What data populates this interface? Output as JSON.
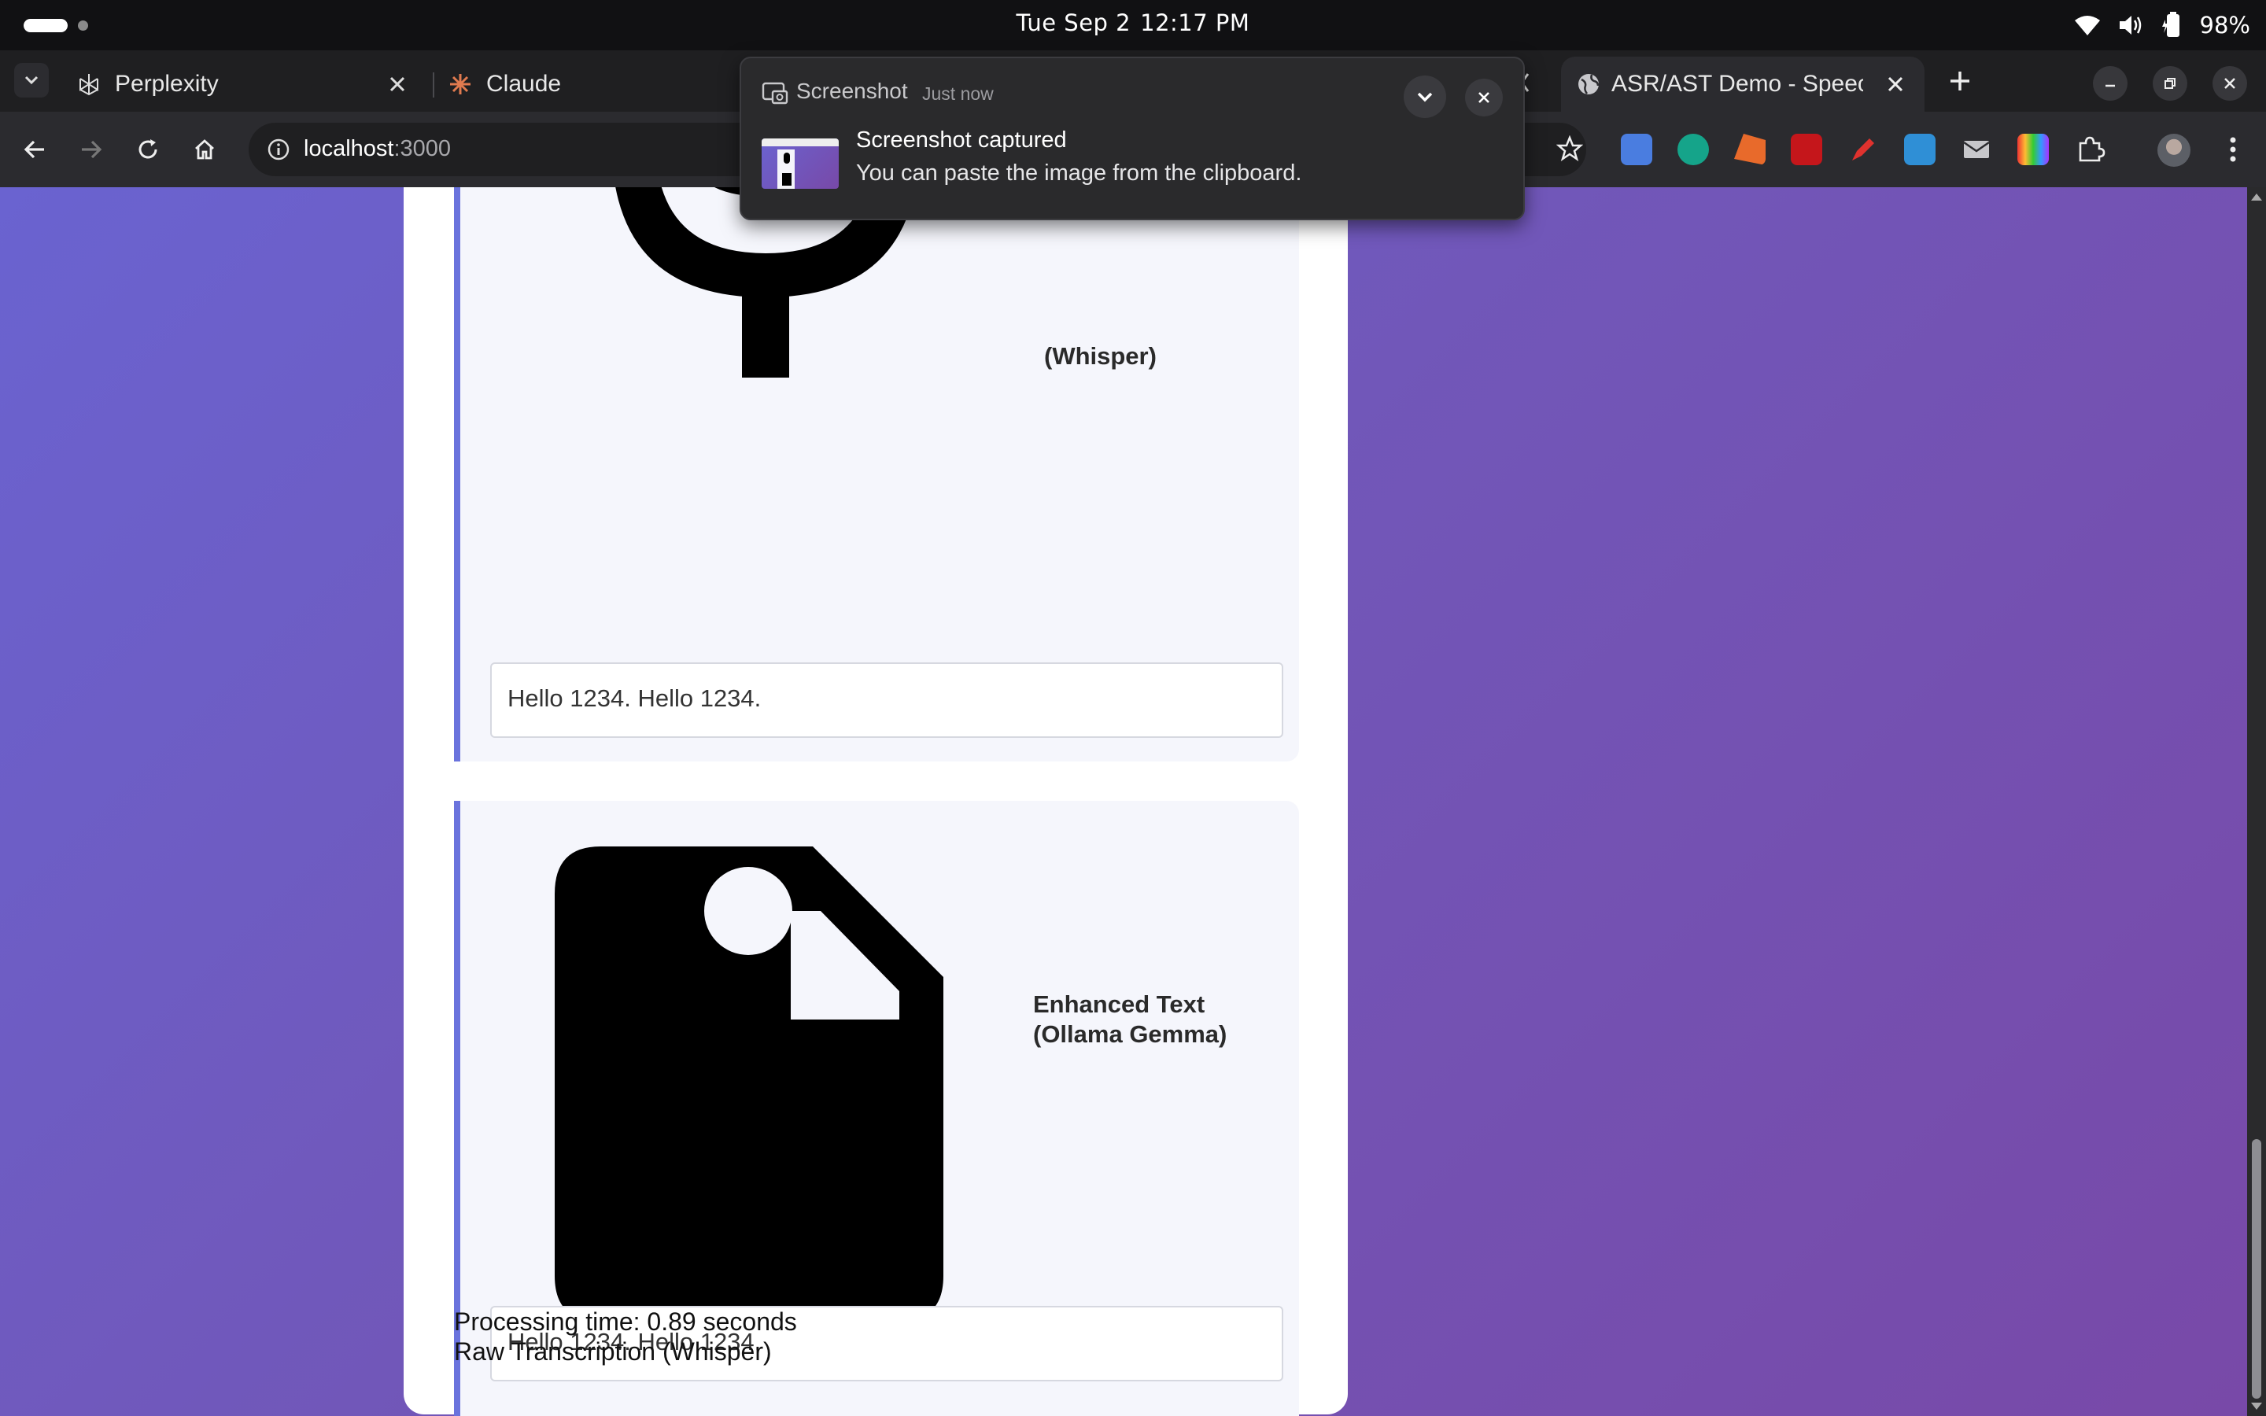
{
  "os": {
    "date": "Tue Sep 2",
    "time": "12:17 PM",
    "battery": "98%",
    "icons": [
      "activities-pill-icon",
      "workspace-dot-icon",
      "wifi-icon",
      "volume-icon",
      "battery-icon"
    ]
  },
  "tabs": [
    {
      "title": "Perplexity",
      "favicon": "perplexity-icon"
    },
    {
      "title": "Claude",
      "favicon": "claude-icon"
    },
    {
      "title": "ASR/AST Demo - Speech",
      "favicon": "globe-icon",
      "active": true
    }
  ],
  "toolbar": {
    "url_host": "localhost",
    "url_port": ":3000",
    "extensions": [
      "google-translate-icon",
      "grammarly-icon",
      "extension-flag-icon",
      "pdf-icon",
      "pen-icon",
      "photo-icon",
      "mail-icon",
      "color-picker-icon",
      "puzzle-icon",
      "profile-avatar"
    ]
  },
  "page": {
    "panel1": {
      "icon": "microphone-icon",
      "label_partial": "(Whisper)",
      "text": "Hello 1234. Hello 1234."
    },
    "panel2": {
      "icon": "document-icon",
      "label_line1": "Enhanced Text",
      "label_line2": "(Ollama Gemma)",
      "text": "Hello 1234. Hello 1234."
    },
    "processing_time": "Processing time: 0.89 seconds",
    "raw_title": "Raw Transcription (Whisper)"
  },
  "notification": {
    "app": "Screenshot",
    "time": "Just now",
    "title": "Screenshot captured",
    "body": "You can paste the image from the clipboard."
  },
  "colors": {
    "accent": "#6a73dd",
    "bg_gradient_start": "#6a63d0",
    "bg_gradient_end": "#7849a8"
  }
}
